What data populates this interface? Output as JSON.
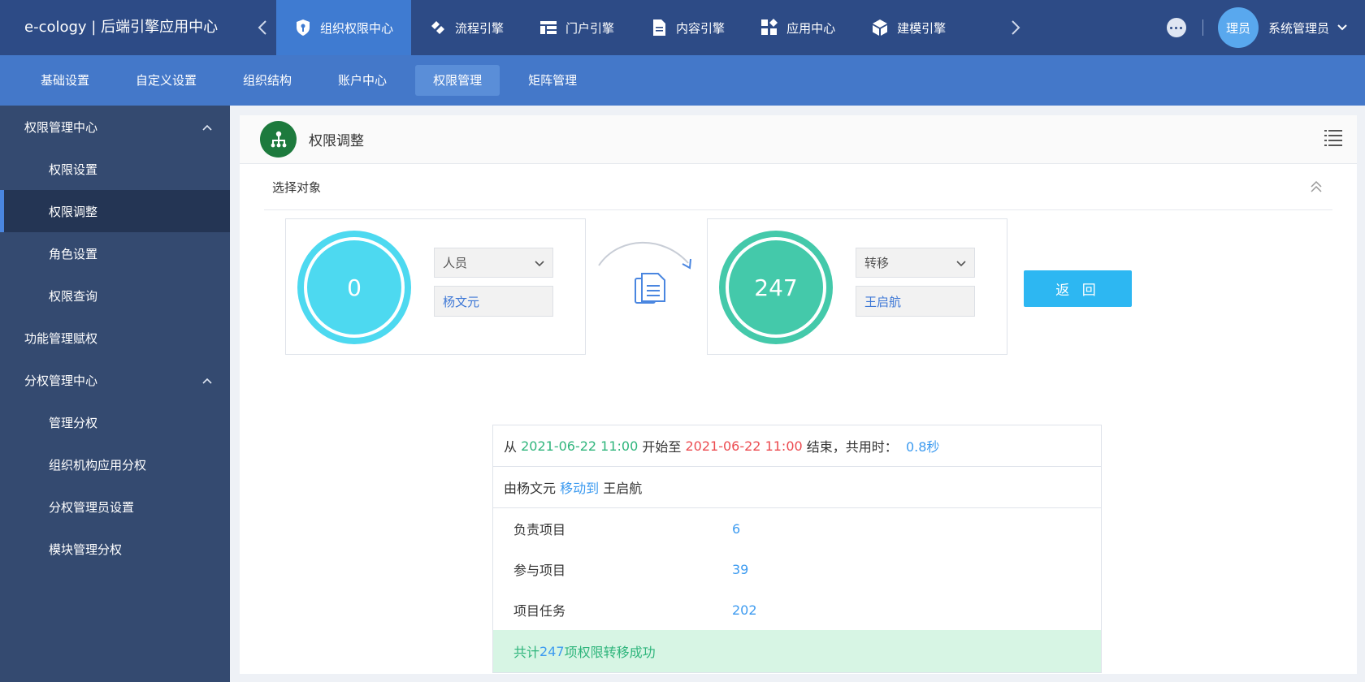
{
  "header": {
    "app_title": "e-cology | 后端引擎应用中心",
    "tabs": [
      {
        "label": "组织权限中心",
        "icon": "shield-key-icon",
        "active": true
      },
      {
        "label": "流程引擎",
        "icon": "workflow-icon",
        "active": false
      },
      {
        "label": "门户引擎",
        "icon": "portal-layout-icon",
        "active": false
      },
      {
        "label": "内容引擎",
        "icon": "document-icon",
        "active": false
      },
      {
        "label": "应用中心",
        "icon": "apps-icon",
        "active": false
      },
      {
        "label": "建模引擎",
        "icon": "cube-icon",
        "active": false
      }
    ],
    "avatar_text": "理员",
    "user_name": "系统管理员"
  },
  "subnav": {
    "items": [
      {
        "label": "基础设置",
        "active": false
      },
      {
        "label": "自定义设置",
        "active": false
      },
      {
        "label": "组织结构",
        "active": false
      },
      {
        "label": "账户中心",
        "active": false
      },
      {
        "label": "权限管理",
        "active": true
      },
      {
        "label": "矩阵管理",
        "active": false
      }
    ]
  },
  "sidebar": {
    "group1": "权限管理中心",
    "group1_items": [
      "权限设置",
      "权限调整",
      "角色设置",
      "权限查询"
    ],
    "single": "功能管理赋权",
    "group2": "分权管理中心",
    "group2_items": [
      "管理分权",
      "组织机构应用分权",
      "分权管理员设置",
      "模块管理分权"
    ],
    "active_item": "权限调整"
  },
  "page": {
    "title": "权限调整",
    "section_title": "选择对象",
    "source": {
      "count": "0",
      "type_select": "人员",
      "person": "杨文元",
      "color": "#4dd9f0"
    },
    "target": {
      "count": "247",
      "type_select": "转移",
      "person": "王启航",
      "color": "#44c9aa"
    },
    "return_button": "返 回"
  },
  "result": {
    "prefix_from": "从",
    "start_time": "2021-06-22 11:00",
    "start_label": "开始至",
    "end_time": "2021-06-22 11:00",
    "end_label": "结束，共用时：",
    "duration": "0.8秒",
    "move_prefix": "由杨文元",
    "move_action": "移动到",
    "move_target": "王启航",
    "rows": [
      {
        "label": "负责项目",
        "value": "6"
      },
      {
        "label": "参与项目",
        "value": "39"
      },
      {
        "label": "项目任务",
        "value": "202"
      }
    ],
    "success_prefix": "共计",
    "success_count": "247",
    "success_suffix": "项权限转移成功"
  },
  "colors": {
    "topbar": "#2d4b86",
    "subnav": "#4478c9",
    "sidebar": "#344a70",
    "accent": "#2db7f2",
    "success": "#2fb57c",
    "danger": "#ec4b50"
  }
}
